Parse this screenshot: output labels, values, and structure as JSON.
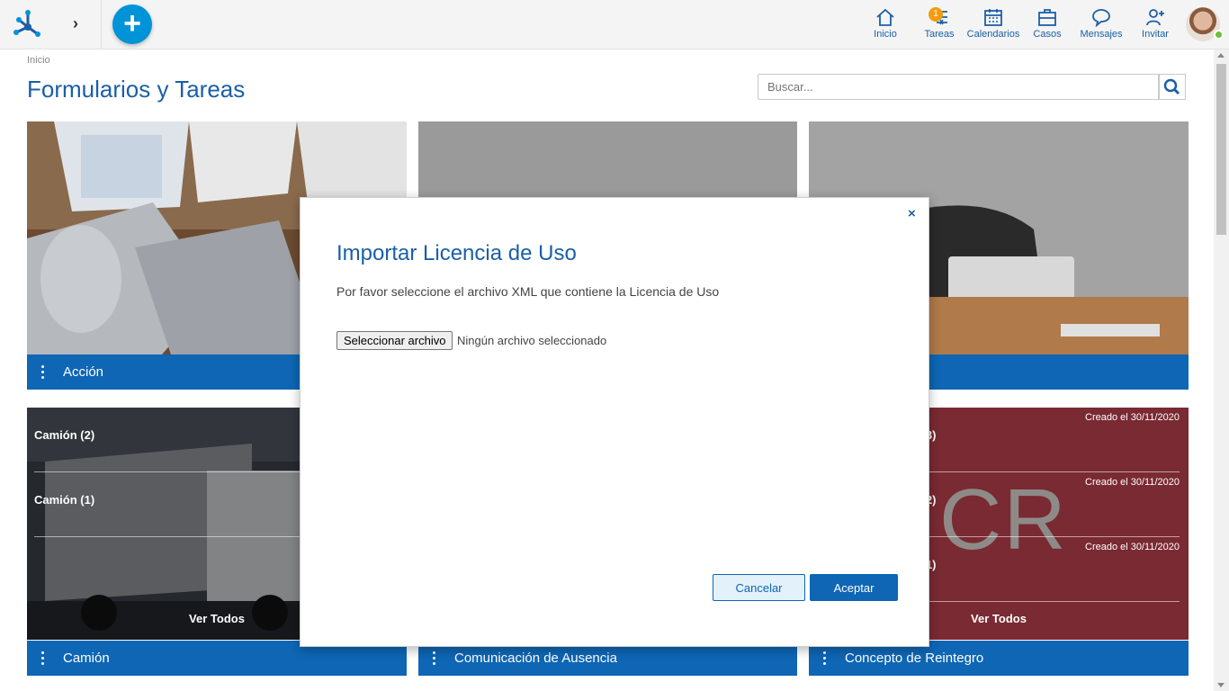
{
  "topbar": {
    "nav": [
      {
        "label": "Inicio",
        "icon": "home-icon"
      },
      {
        "label": "Tareas",
        "icon": "tasks-icon",
        "badge": "1"
      },
      {
        "label": "Calendarios",
        "icon": "calendar-icon"
      },
      {
        "label": "Casos",
        "icon": "briefcase-icon"
      },
      {
        "label": "Mensajes",
        "icon": "chat-icon"
      },
      {
        "label": "Invitar",
        "icon": "add-user-icon"
      }
    ],
    "add_label": "+",
    "expand_label": "›"
  },
  "header": {
    "breadcrumb": "Inicio",
    "title": "Formularios y Tareas",
    "search_placeholder": "Buscar..."
  },
  "cards_row1": [
    {
      "label": "Acción"
    },
    {
      "label": ""
    },
    {
      "label": ""
    }
  ],
  "card_camion": {
    "label": "Camión",
    "items": [
      "Camión (2)",
      "Camión (1)"
    ],
    "see_all": "Ver Todos"
  },
  "card_ausencia": {
    "label": "Comunicación de Ausencia"
  },
  "card_reintegro": {
    "label": "Concepto de Reintegro",
    "initials": "CR",
    "items": [
      {
        "title": "o (3)",
        "date": "Creado el 30/11/2020"
      },
      {
        "title": "o (2)",
        "date": "Creado el 30/11/2020"
      },
      {
        "title": "o (1)",
        "date": "Creado el 30/11/2020"
      }
    ],
    "see_all": "Ver Todos"
  },
  "dialog": {
    "close": "×",
    "title": "Importar Licencia de Uso",
    "description": "Por favor seleccione el archivo XML que contiene la Licencia de Uso",
    "file_button": "Seleccionar archivo",
    "file_none": "Ningún archivo seleccionado",
    "cancel": "Cancelar",
    "accept": "Aceptar"
  },
  "colors": {
    "brand_blue": "#0e66b5",
    "title_blue": "#1a5fa7",
    "add_button": "#0093d8",
    "reintegro_bg": "#7a2a32",
    "badge": "#f39c12"
  }
}
